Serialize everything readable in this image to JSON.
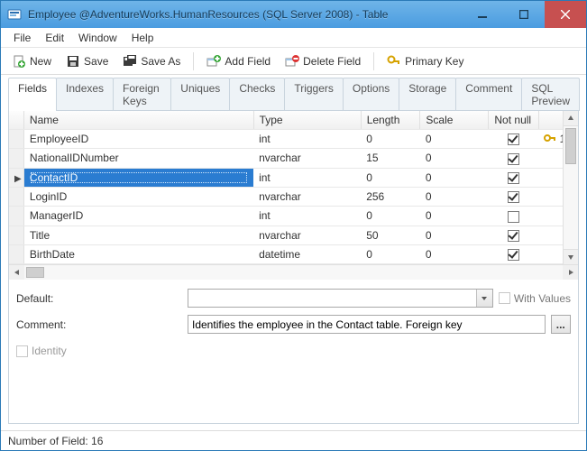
{
  "window": {
    "title": "Employee @AdventureWorks.HumanResources (SQL Server 2008) - Table"
  },
  "menu": {
    "file": "File",
    "edit": "Edit",
    "window": "Window",
    "help": "Help"
  },
  "toolbar": {
    "new": "New",
    "save": "Save",
    "save_as": "Save As",
    "add_field": "Add Field",
    "delete_field": "Delete Field",
    "primary_key": "Primary Key"
  },
  "tabs": {
    "fields": "Fields",
    "indexes": "Indexes",
    "foreign_keys": "Foreign Keys",
    "uniques": "Uniques",
    "checks": "Checks",
    "triggers": "Triggers",
    "options": "Options",
    "storage": "Storage",
    "comment": "Comment",
    "sql_preview": "SQL Preview",
    "active": "fields"
  },
  "grid": {
    "headers": {
      "name": "Name",
      "type": "Type",
      "length": "Length",
      "scale": "Scale",
      "not_null": "Not null"
    },
    "rows": [
      {
        "name": "EmployeeID",
        "type": "int",
        "length": "0",
        "scale": "0",
        "not_null": true,
        "pk": "1",
        "selected": false
      },
      {
        "name": "NationalIDNumber",
        "type": "nvarchar",
        "length": "15",
        "scale": "0",
        "not_null": true,
        "pk": "",
        "selected": false
      },
      {
        "name": "ContactID",
        "type": "int",
        "length": "0",
        "scale": "0",
        "not_null": true,
        "pk": "",
        "selected": true
      },
      {
        "name": "LoginID",
        "type": "nvarchar",
        "length": "256",
        "scale": "0",
        "not_null": true,
        "pk": "",
        "selected": false
      },
      {
        "name": "ManagerID",
        "type": "int",
        "length": "0",
        "scale": "0",
        "not_null": false,
        "pk": "",
        "selected": false
      },
      {
        "name": "Title",
        "type": "nvarchar",
        "length": "50",
        "scale": "0",
        "not_null": true,
        "pk": "",
        "selected": false
      },
      {
        "name": "BirthDate",
        "type": "datetime",
        "length": "0",
        "scale": "0",
        "not_null": true,
        "pk": "",
        "selected": false
      }
    ]
  },
  "form": {
    "default_label": "Default:",
    "default_value": "",
    "with_values_label": "With Values",
    "with_values_checked": false,
    "with_values_enabled": false,
    "comment_label": "Comment:",
    "comment_value": "Identifies the employee in the Contact table. Foreign key",
    "identity_label": "Identity",
    "identity_checked": false,
    "identity_enabled": false
  },
  "status": {
    "text": "Number of Field: 16"
  }
}
